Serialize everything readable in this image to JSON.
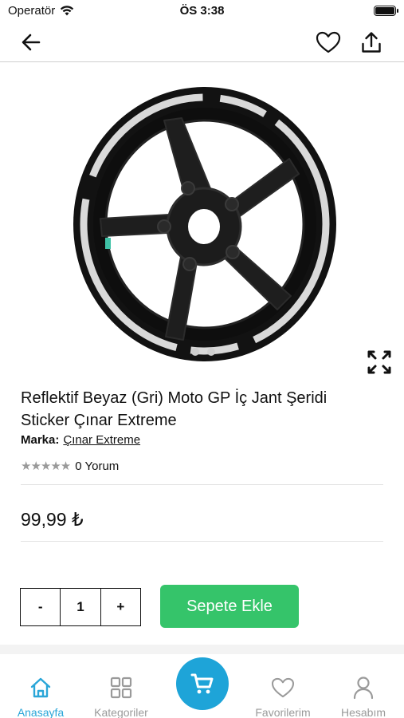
{
  "status_bar": {
    "carrier": "Operatör",
    "time": "ÖS 3:38"
  },
  "product": {
    "title": "Reflektif Beyaz (Gri) Moto GP İç Jant Şeridi Sticker Çınar Extreme",
    "brand_label": "Marka:",
    "brand_name": "Çınar Extreme",
    "rating": 0,
    "stars": "★★★★★",
    "review_text": "0 Yorum",
    "price": "99,99 ₺"
  },
  "cart": {
    "decrement": "-",
    "quantity": "1",
    "increment": "+",
    "add_label": "Sepete Ekle"
  },
  "tabs": [
    {
      "label": "Anasayfa",
      "icon": "home-icon",
      "active": true
    },
    {
      "label": "Kategoriler",
      "icon": "grid-icon",
      "active": false
    },
    {
      "label": "Favorilerim",
      "icon": "heart-icon",
      "active": false
    },
    {
      "label": "Hesabım",
      "icon": "user-icon",
      "active": false
    }
  ],
  "colors": {
    "accent": "#1ea4d8",
    "active_tab": "#2aa6d8",
    "cart_button": "#35c46a",
    "inactive": "#9a9a9a"
  }
}
